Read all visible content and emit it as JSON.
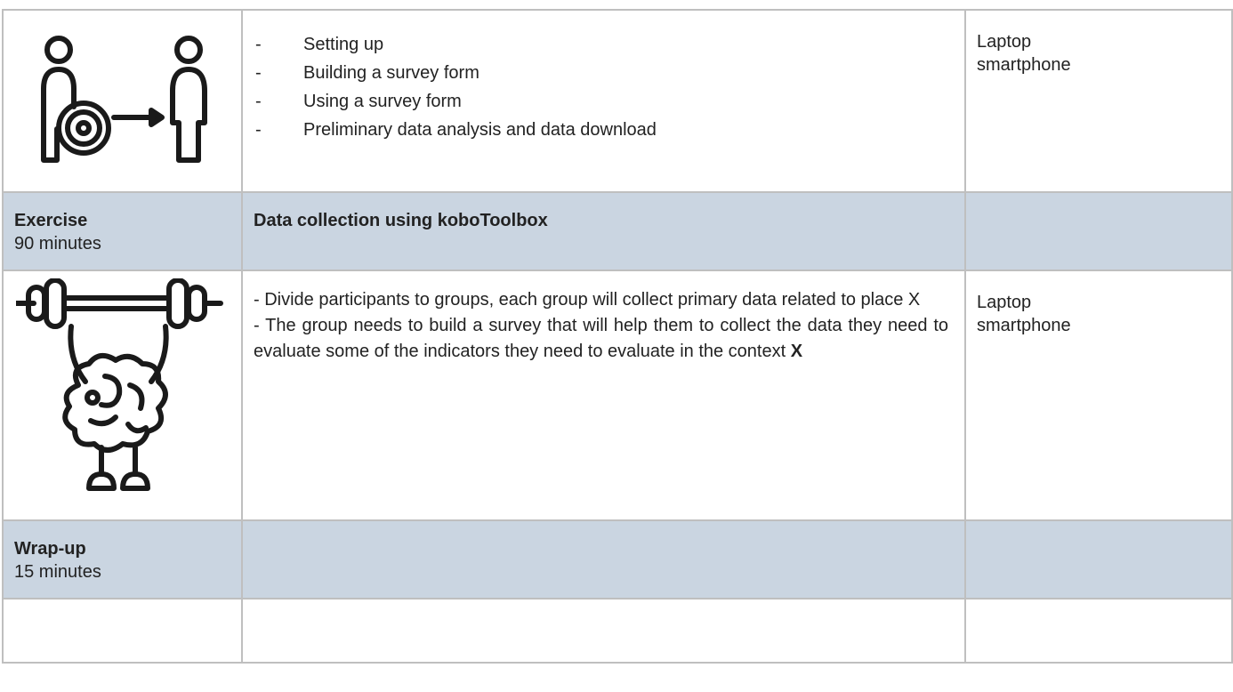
{
  "rows": {
    "setup": {
      "bullets": [
        "Setting up",
        "Building a survey form",
        "Using a survey form",
        "Preliminary data analysis and data download"
      ],
      "bullet_marker": "-",
      "equipment": [
        "Laptop",
        "smartphone"
      ],
      "icon": "person-gear-transfer-icon"
    },
    "exercise": {
      "title": "Exercise",
      "duration": "90 minutes",
      "activity": "Data collection using koboToolbox",
      "lines": [
        "- Divide participants to groups, each group will collect primary data related to place X",
        "- The group needs to build a survey that will help them to collect the data they need to evaluate some of the indicators they need to evaluate in the context "
      ],
      "emphasis": "X",
      "equipment": [
        "Laptop",
        "smartphone"
      ],
      "icon": "brain-weightlifting-icon"
    },
    "wrapup": {
      "title": "Wrap-up",
      "duration": "15 minutes"
    }
  },
  "colors": {
    "header_bg": "#cad5e1",
    "border": "#bfbfbf",
    "icon_stroke": "#1a1a1a"
  }
}
